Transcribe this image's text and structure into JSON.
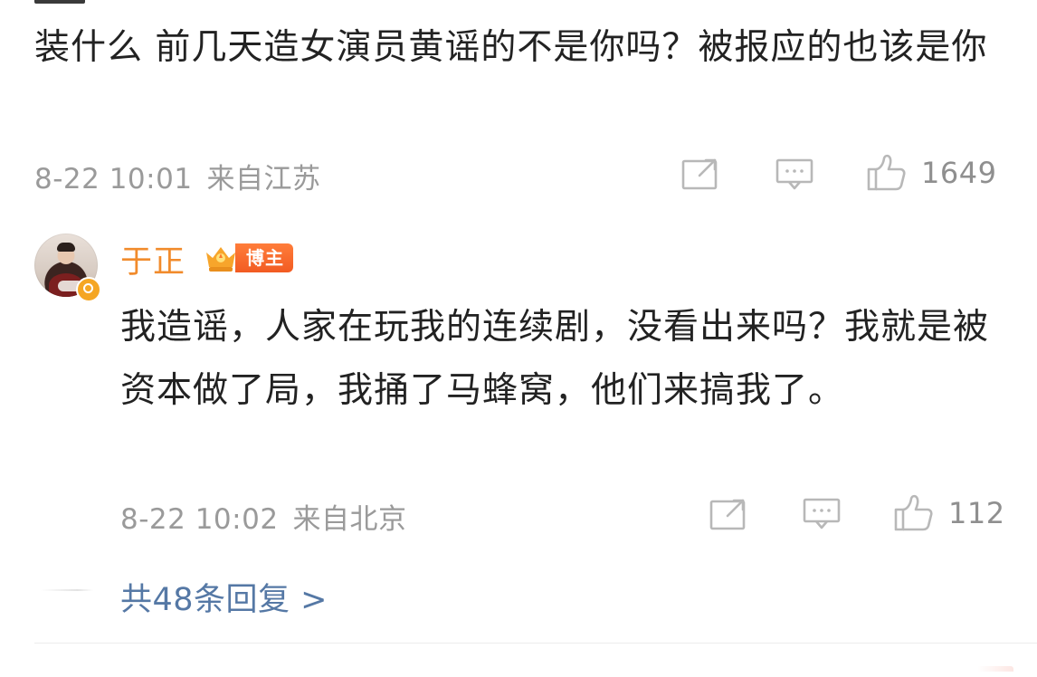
{
  "root_comment": {
    "text": "装什么 前几天造女演员黄谣的不是你吗？被报应的也该是你",
    "time": "8-22 10:01",
    "location": "来自江苏",
    "like_count": "1649"
  },
  "reply": {
    "author": {
      "name": "于正",
      "badge_label": "博主"
    },
    "text": "我造谣，人家在玩我的连续剧，没看出来吗？我就是被资本做了局，我捅了马蜂窝，他们来搞我了。",
    "time": "8-22 10:02",
    "location": "来自北京",
    "like_count": "112"
  },
  "thread": {
    "replies_link": "共48条回复 >"
  },
  "colors": {
    "author_name": "#f18b2c",
    "replies_link": "#5578a5",
    "meta_text": "#9a9a9a",
    "badge_gradient_start": "#ff7d3a",
    "badge_gradient_end": "#f25b22"
  },
  "icons": {
    "share": "share-icon",
    "comment": "comment-icon",
    "like": "like-icon",
    "verified": "verified-badge-icon",
    "crown": "crown-icon"
  }
}
